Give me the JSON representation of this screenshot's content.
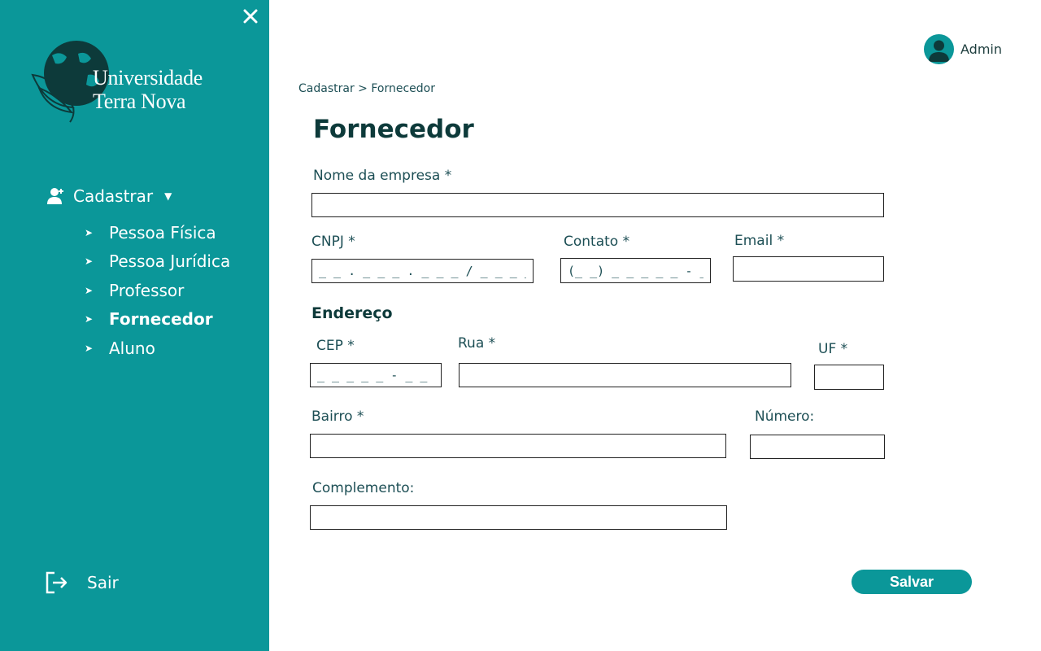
{
  "sidebar": {
    "logo": {
      "line1": "Universidade",
      "line2": "Terra Nova"
    },
    "menu": {
      "heading": "Cadastrar",
      "items": [
        {
          "label": "Pessoa Física",
          "active": false
        },
        {
          "label": "Pessoa Jurídica",
          "active": false
        },
        {
          "label": "Professor",
          "active": false
        },
        {
          "label": "Fornecedor",
          "active": true
        },
        {
          "label": "Aluno",
          "active": false
        }
      ]
    },
    "logout_label": "Sair"
  },
  "header": {
    "user_name": "Admin"
  },
  "breadcrumb": "Cadastrar > Fornecedor",
  "page_title": "Fornecedor",
  "form": {
    "nome_label": "Nome da empresa *",
    "cnpj_label": "CNPJ *",
    "cnpj_placeholder": "_ _ . _ _ _ . _ _ _ / _ _ _ _-_ _",
    "contato_label": "Contato *",
    "contato_placeholder": "(_ _) _ _ _ _ _ - _ _ _ _",
    "email_label": "Email *",
    "endereco_title": "Endereço",
    "cep_label": "CEP *",
    "cep_placeholder": "_ _ _ _ _ - _ _ _",
    "rua_label": "Rua *",
    "uf_label": "UF *",
    "bairro_label": "Bairro *",
    "numero_label": "Número:",
    "complemento_label": "Complemento:",
    "save_label": "Salvar"
  },
  "colors": {
    "sidebar": "#0b9799",
    "accent": "#0b9799",
    "heading": "#0d3a3a",
    "text": "#1d4f55"
  }
}
